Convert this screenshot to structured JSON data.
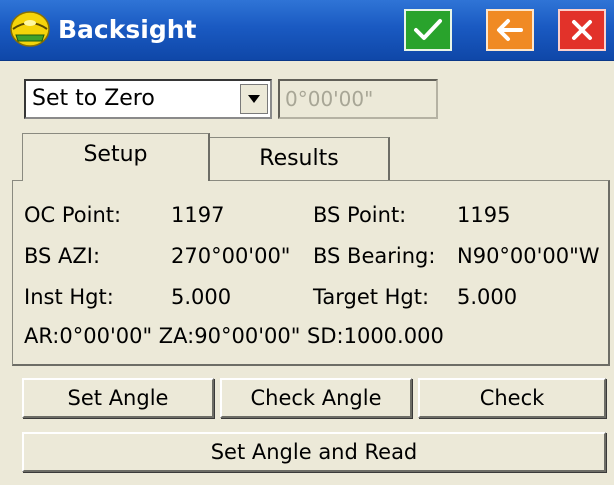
{
  "window": {
    "title": "Backsight",
    "icons": {
      "app": "helmet-icon",
      "ok": "check-icon",
      "back": "arrow-left-icon",
      "close": "close-icon"
    },
    "colors": {
      "titlebar": "#1a5ac2",
      "ok": "#29a32c",
      "back": "#f08a24",
      "close": "#e2322a"
    }
  },
  "mode": {
    "selected": "Set to Zero",
    "angle_value": "0°00'00\""
  },
  "tabs": [
    {
      "label": "Setup",
      "active": true
    },
    {
      "label": "Results",
      "active": false
    }
  ],
  "setup": {
    "oc_point_label": "OC Point:",
    "oc_point_value": "1197",
    "bs_point_label": "BS Point:",
    "bs_point_value": "1195",
    "bs_azi_label": "BS AZI:",
    "bs_azi_value": "270°00'00\"",
    "bs_bearing_label": "BS Bearing:",
    "bs_bearing_value": "N90°00'00\"W",
    "inst_hgt_label": "Inst Hgt:",
    "inst_hgt_value": "5.000",
    "target_hgt_label": "Target Hgt:",
    "target_hgt_value": "5.000",
    "summary_line": "AR:0°00'00\" ZA:90°00'00\" SD:1000.000"
  },
  "buttons": {
    "set_angle": "Set Angle",
    "check_angle": "Check Angle",
    "check": "Check",
    "set_angle_and_read": "Set Angle and Read"
  }
}
